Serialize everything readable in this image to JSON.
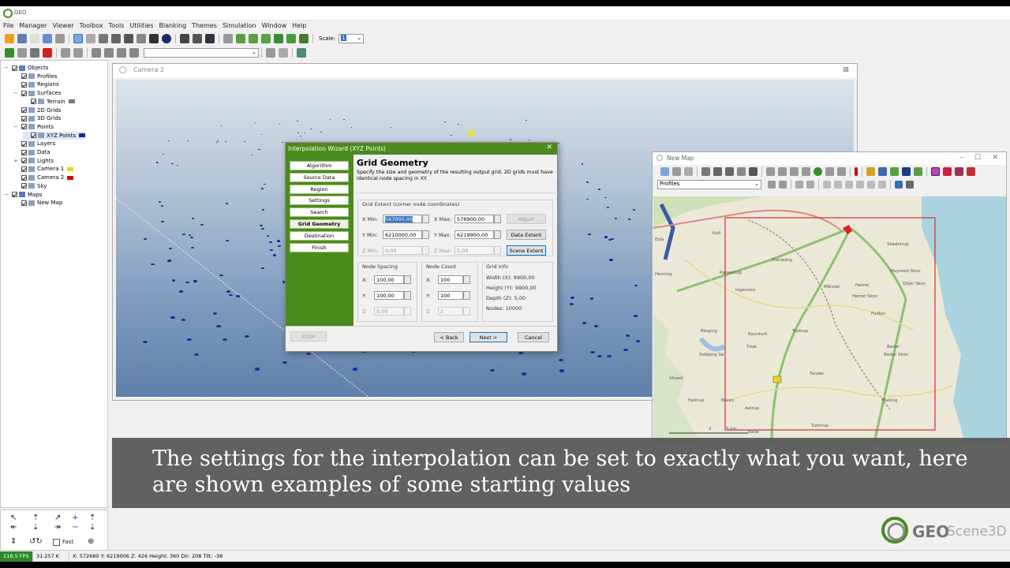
{
  "app": {
    "title": "GEO"
  },
  "menu": [
    "File",
    "Manager",
    "Viewer",
    "Toolbox",
    "Tools",
    "Utilities",
    "Blanking",
    "Themes",
    "Simulation",
    "Window",
    "Help"
  ],
  "toolbar": {
    "scale_label": "Scale:",
    "scale_value": "1"
  },
  "tree": [
    {
      "label": "Objects",
      "level": 0,
      "exp": "−"
    },
    {
      "label": "Profiles",
      "level": 1
    },
    {
      "label": "Regions",
      "level": 1
    },
    {
      "label": "Surfaces",
      "level": 1,
      "exp": "−"
    },
    {
      "label": "Terrain",
      "level": 2,
      "swatch": "#777"
    },
    {
      "label": "2D Grids",
      "level": 1
    },
    {
      "label": "3D Grids",
      "level": 1
    },
    {
      "label": "Points",
      "level": 1,
      "exp": "−"
    },
    {
      "label": "XYZ Points",
      "level": 2,
      "swatch": "#1a2a9a",
      "selected": true
    },
    {
      "label": "Layers",
      "level": 1
    },
    {
      "label": "Data",
      "level": 1
    },
    {
      "label": "Lights",
      "level": 1,
      "exp": "+"
    },
    {
      "label": "Camera 1",
      "level": 1,
      "swatch": "#e8d800"
    },
    {
      "label": "Camera 2",
      "level": 1,
      "swatch": "#d00"
    },
    {
      "label": "Sky",
      "level": 1
    },
    {
      "label": "Maps",
      "level": 0,
      "exp": "−"
    },
    {
      "label": "New Map",
      "level": 1
    }
  ],
  "navpad": {
    "fast_label": "Fast"
  },
  "camera": {
    "title": "Camera 2"
  },
  "wizard": {
    "title": "Interpolation Wizard (XYZ Points)",
    "steps": [
      "Algorithm",
      "Source Data",
      "Region",
      "Settings",
      "Search",
      "Grid Geometry",
      "Destination",
      "Finish"
    ],
    "active_step": "Grid Geometry",
    "heading": "Grid Geometry",
    "description": "Specify the size and geometry of the resulting output grid. 2D grids  must have identical node spacing in XY.",
    "extent_label": "Grid Extent (corner node coordinates)",
    "xmin_label": "X Min:",
    "xmin": "567000,00",
    "xmax_label": "X Max:",
    "xmax": "576900,00",
    "ymin_label": "Y Min:",
    "ymin": "6210000,00",
    "ymax_label": "Y Max:",
    "ymax": "6219900,00",
    "zmin_label": "Z Min:",
    "zmin": "0,00",
    "zmax_label": "Z Max:",
    "zmax": "5,00",
    "adjust": "Adjust",
    "data_extent": "Data Extent",
    "scene_extent": "Scene Extent",
    "spacing_label": "Node Spacing",
    "count_label": "Node Count",
    "info_label": "Grid Info",
    "x_label": "X:",
    "y_label": "Y:",
    "z_label": "Z:",
    "sx": "100,00",
    "sy": "100,00",
    "sz": "5,00",
    "cx": "100",
    "cy": "100",
    "cz": "2",
    "info_width": "Width (X): 9900,00",
    "info_height": "Height (Y): 9900,00",
    "info_depth": "Depth (Z): 5,00",
    "info_nodes": "Nodes: 10000",
    "stop": "STOP",
    "back": "< Back",
    "next": "Next >",
    "cancel": "Cancel"
  },
  "map": {
    "title": "New Map",
    "layer_select": "Profiles",
    "labels": [
      "Herning",
      "Kolt",
      "Esla",
      "Tranbjerg",
      "Ingerslev",
      "Mårslet",
      "Hørret",
      "Tiset",
      "Ravnholt",
      "Beder",
      "Testrup",
      "Fulden",
      "Bleging",
      "Solbjerg Sø",
      "Tander",
      "Vilvød",
      "Fastrup",
      "Aelrup",
      "Malling",
      "Tulstrup",
      "Balle",
      "Bislev",
      "Kanestrup",
      "Skødstrup",
      "Mayreed Skov",
      "Giljer Skov",
      "Hørret Skov",
      "Beder Skov"
    ],
    "scale_labels": [
      "2",
      "3 km"
    ]
  },
  "caption": {
    "line1": "The settings for the interpolation can be set to exactly what you want, here",
    "line2": "are shown examples of some starting values"
  },
  "brand": {
    "name": "GEO",
    "suffix": "Scene3D"
  },
  "status": {
    "fps": "118,5 FPS",
    "tris": "31.257 K",
    "coords": "X: 572680  Y: 6219006  Z: 426  Height: 360  Dir: 208  Tilt: -38"
  },
  "colors": {
    "wizard_green": "#4b8a1c",
    "caption_bg": "#555555",
    "point_blue": "#1a2a9a"
  }
}
